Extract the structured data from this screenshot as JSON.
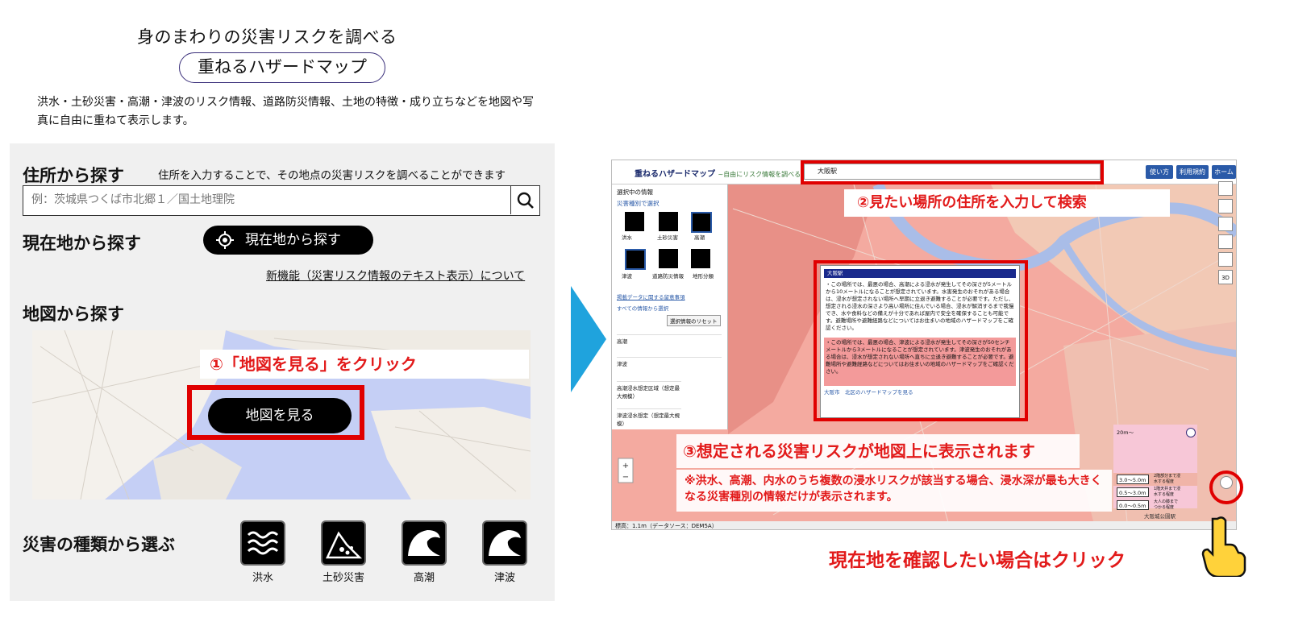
{
  "left": {
    "subtitle": "身のまわりの災害リスクを調べる",
    "site_title": "重ねるハザードマップ",
    "intro": "洪水・土砂災害・高潮・津波のリスク情報、道路防災情報、土地の特徴・成り立ちなどを地図や写真に自由に重ねて表示します。",
    "address_heading": "住所から探す",
    "address_hint": "住所を入力することで、その地点の災害リスクを調べることができます",
    "search_placeholder": "例：茨城県つくば市北郷１／国土地理院",
    "location_heading": "現在地から探す",
    "location_button": "現在地から探す",
    "new_feature_link": "新機能（災害リスク情報のテキスト表示）について",
    "map_heading": "地図から探す",
    "map_callout": "①「地図を見る」をクリック",
    "map_button": "地図を見る",
    "hazard_heading": "災害の種類から選ぶ",
    "hazards": [
      {
        "label": "洪水",
        "icon": "flood-icon"
      },
      {
        "label": "土砂災害",
        "icon": "landslide-icon"
      },
      {
        "label": "高潮",
        "icon": "storm-surge-icon"
      },
      {
        "label": "津波",
        "icon": "tsunami-icon"
      }
    ]
  },
  "right": {
    "app_title": "重ねるハザードマップ",
    "app_tagline": "~自由にリスク情報を調べる~",
    "search_value": "大阪駅",
    "nav": [
      "使い方",
      "利用規約",
      "ホーム"
    ],
    "callout2": "②見たい場所の住所を入力して検索",
    "callout3": "③想定される災害リスクが地図上に表示されます",
    "note": "※洪水、高潮、内水のうち複数の浸水リスクが該当する場合、浸水深が最も大きくなる災害種別の情報だけが表示されます。",
    "side": {
      "title": "選択中の情報",
      "by_type": "災害種別で選択",
      "icons": [
        "洪水",
        "土砂災害",
        "高潮",
        "津波",
        "道路防災情報",
        "地形分類"
      ],
      "road_note": "掲載データに関する留意事項",
      "all_info": "すべての情報から選択",
      "reset": "選択情報のリセット",
      "items": [
        "高潮",
        "津波",
        "高潮浸水想定区域（想定最大規模）",
        "津波浸水想定（想定最大規模）"
      ]
    },
    "popup": {
      "title": "大阪駅",
      "para1": "・この場所では、最悪の場合、高潮による浸水が発生してその深さが5メートルから10メートルになることが想定されています。水害発生のおそれがある場合は、浸水が想定されない場所へ早期に立退き避難することが必要です。ただし、想定される浸水の深さより高い場所に住んでいる場合、浸水が解消するまで我慢でき、水や食料などの備えが十分であれば屋内で安全を確保することも可能です。避難場所や避難経路などについてはお住まいの地域のハザードマップをご確認ください。",
      "para2": "・この場所では、最悪の場合、津波による浸水が発生してその深さが50センチメートルから3メートルになることが想定されています。津波発生のおそれがある場合は、浸水が想定されない場所へ直ちに立退き避難することが必要です。避難場所や避難経路などについてはお住まいの地域のハザードマップをご確認ください。",
      "link": "大阪市　北区のハザードマップを見る"
    },
    "legend": [
      "20m～",
      "3.0～5.0m",
      "0.5～3.0m",
      "0.0～0.5m"
    ],
    "legend_notes": [
      "2階部分まで浸水する程度",
      "1階天井まで浸水する程度",
      "大人の膝までつかる程度"
    ],
    "station_label": "大阪城公園駅",
    "status": "標高：1.1m（データソース：DEM5A）"
  },
  "footer_callout": "現在地を確認したい場合はクリック",
  "colors": {
    "accent_red": "#e00000",
    "arrow_blue": "#1fa3dd",
    "nav_blue": "#2a5aa8"
  }
}
